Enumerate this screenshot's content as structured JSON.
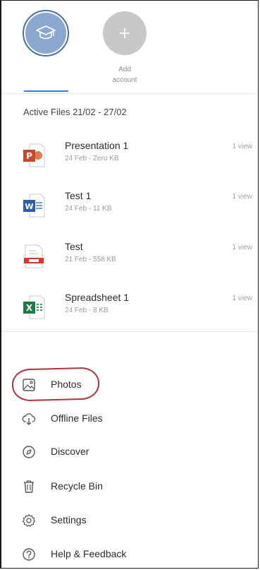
{
  "accounts": {
    "add_label": "Add\naccount"
  },
  "active_files": {
    "title": "Active Files 21/02 - 27/02",
    "items": [
      {
        "name": "Presentation 1",
        "meta": "24 Feb - Zero KB",
        "views": "1 view",
        "icon": "powerpoint-icon",
        "color": "#c9452f"
      },
      {
        "name": "Test 1",
        "meta": "24 Feb - 11 KB",
        "views": "1 view",
        "icon": "word-icon",
        "color": "#2b5cad"
      },
      {
        "name": "Test",
        "meta": "21 Feb - 558 KB",
        "views": "1 view",
        "icon": "pdf-icon",
        "color": "#d23a2a"
      },
      {
        "name": "Spreadsheet 1",
        "meta": "24 Feb - 8 KB",
        "views": "1 view",
        "icon": "excel-icon",
        "color": "#1f7a45"
      }
    ]
  },
  "menu": {
    "items": [
      {
        "label": "Photos",
        "icon": "photo-icon"
      },
      {
        "label": "Offline Files",
        "icon": "offline-cloud-icon"
      },
      {
        "label": "Discover",
        "icon": "discover-icon"
      },
      {
        "label": "Recycle Bin",
        "icon": "trash-icon"
      },
      {
        "label": "Settings",
        "icon": "gear-icon"
      },
      {
        "label": "Help & Feedback",
        "icon": "help-icon"
      }
    ]
  },
  "colors": {
    "accent": "#3e7bd9",
    "avatar": "#8aa7cf",
    "annotation": "#b3353b"
  }
}
